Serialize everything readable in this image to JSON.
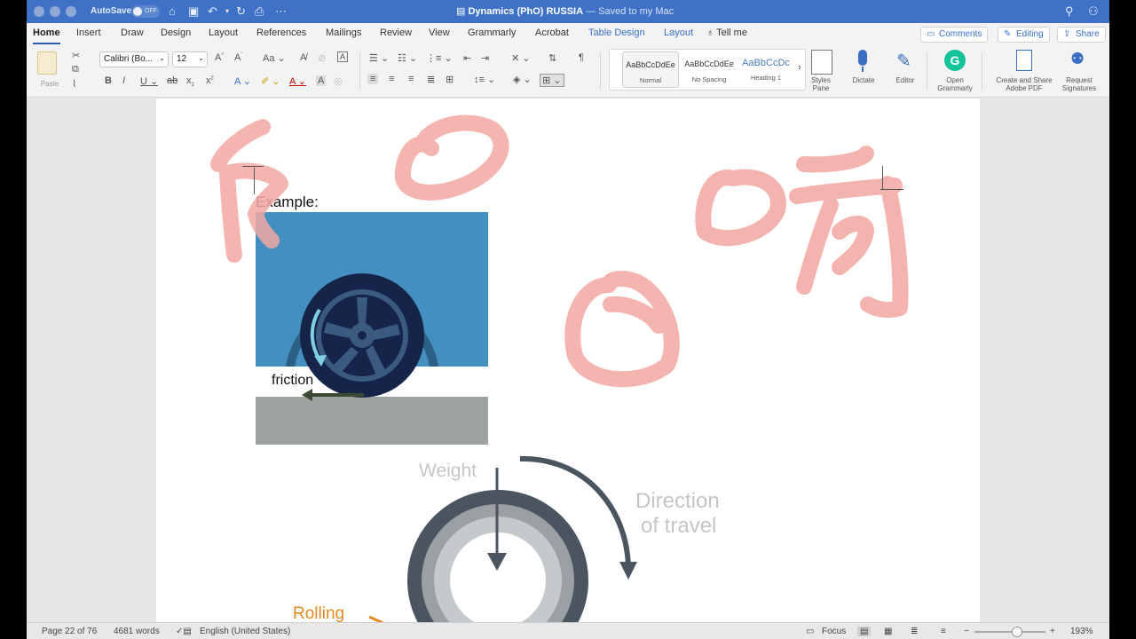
{
  "titlebar": {
    "autosave_label": "AutoSave",
    "toggle_state": "OFF",
    "doc_name": "Dynamics (PhO) RUSSIA",
    "saved_status": " — Saved to my Mac"
  },
  "tabs": [
    "Home",
    "Insert",
    "Draw",
    "Design",
    "Layout",
    "References",
    "Mailings",
    "Review",
    "View",
    "Grammarly",
    "Acrobat",
    "Table Design",
    "Layout",
    "Tell me"
  ],
  "right_buttons": {
    "comments": "Comments",
    "editing": "Editing",
    "share": "Share"
  },
  "ribbon": {
    "paste_label": "Paste",
    "font_name": "Calibri (Bo...",
    "font_size": "12",
    "styles": [
      {
        "sample": "AaBbCcDdEe",
        "name": "Normal"
      },
      {
        "sample": "AaBbCcDdEe",
        "name": "No Spacing"
      },
      {
        "sample": "AaBbCcDc",
        "name": "Heading 1"
      }
    ],
    "styles_pane": "Styles Pane",
    "dictate": "Dictate",
    "editor": "Editor",
    "open_grammarly": "Open Grammarly",
    "create_share_pdf": "Create and Share Adobe PDF",
    "request_signatures": "Request Signatures"
  },
  "document": {
    "example_label": "Example:",
    "friction_label": "friction",
    "weight_label": "Weight",
    "direction_label_1": "Direction",
    "direction_label_2": "of travel",
    "rolling_label": "Rolling"
  },
  "status": {
    "page": "Page 22 of 76",
    "words": "4681 words",
    "language": "English (United States)",
    "focus": "Focus",
    "zoom": "193%"
  },
  "colors": {
    "titlebar": "#3f72c6",
    "accent": "#2b5eb3",
    "ink": "#f2a8a2",
    "diagram_blue": "#428fc0",
    "tire_navy": "#16244a",
    "ground_gray": "#9ea3a0"
  }
}
